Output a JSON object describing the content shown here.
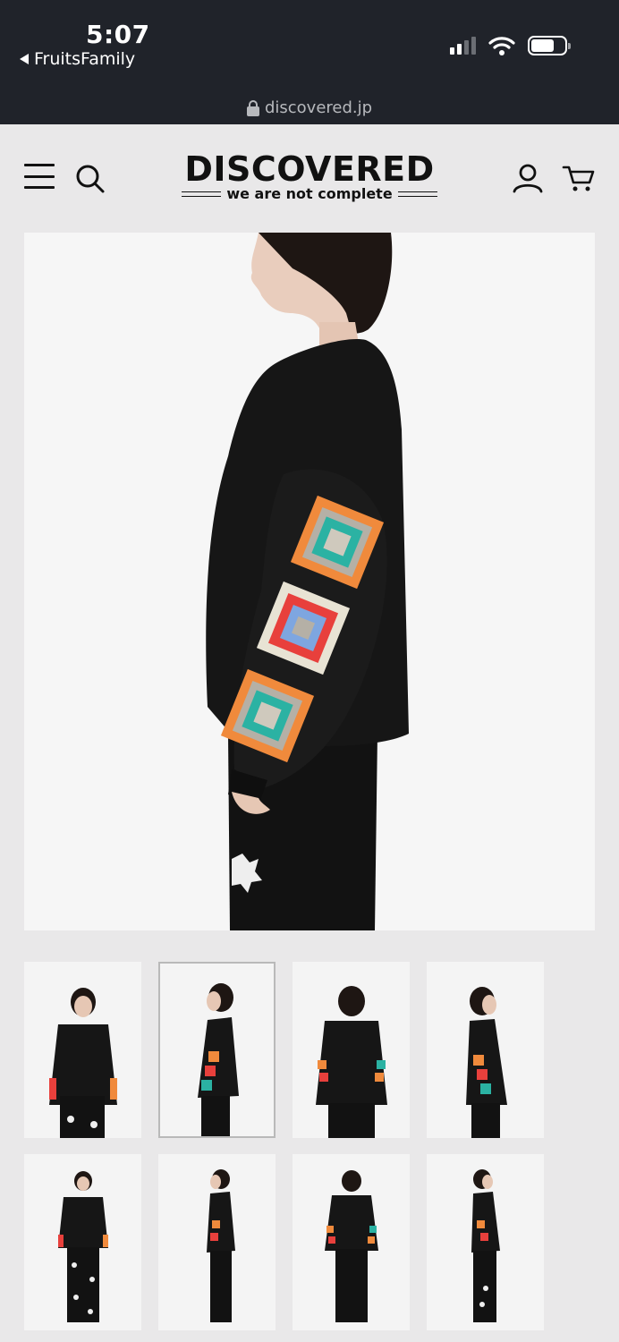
{
  "status_bar": {
    "time": "5:07",
    "back_app": "FruitsFamily",
    "url": "discovered.jp",
    "battery_level": 0.7,
    "signal_bars_active": 2
  },
  "header": {
    "logo_text": "DISCOVERED",
    "logo_tagline": "we are not complete",
    "icons": [
      "menu-icon",
      "search-icon",
      "account-icon",
      "cart-icon"
    ]
  },
  "gallery": {
    "selected_index": 1,
    "thumb_count": 8,
    "thumb_views": [
      "front",
      "side",
      "back",
      "side",
      "front",
      "side",
      "back",
      "side"
    ]
  },
  "colors": {
    "status_bg": "#20232a",
    "page_bg": "#e9e8e9",
    "garment": "#151515",
    "crochet": [
      "#f08a3c",
      "#2bb2a3",
      "#e8403c",
      "#7ea6e0",
      "#b5b0a6"
    ]
  }
}
